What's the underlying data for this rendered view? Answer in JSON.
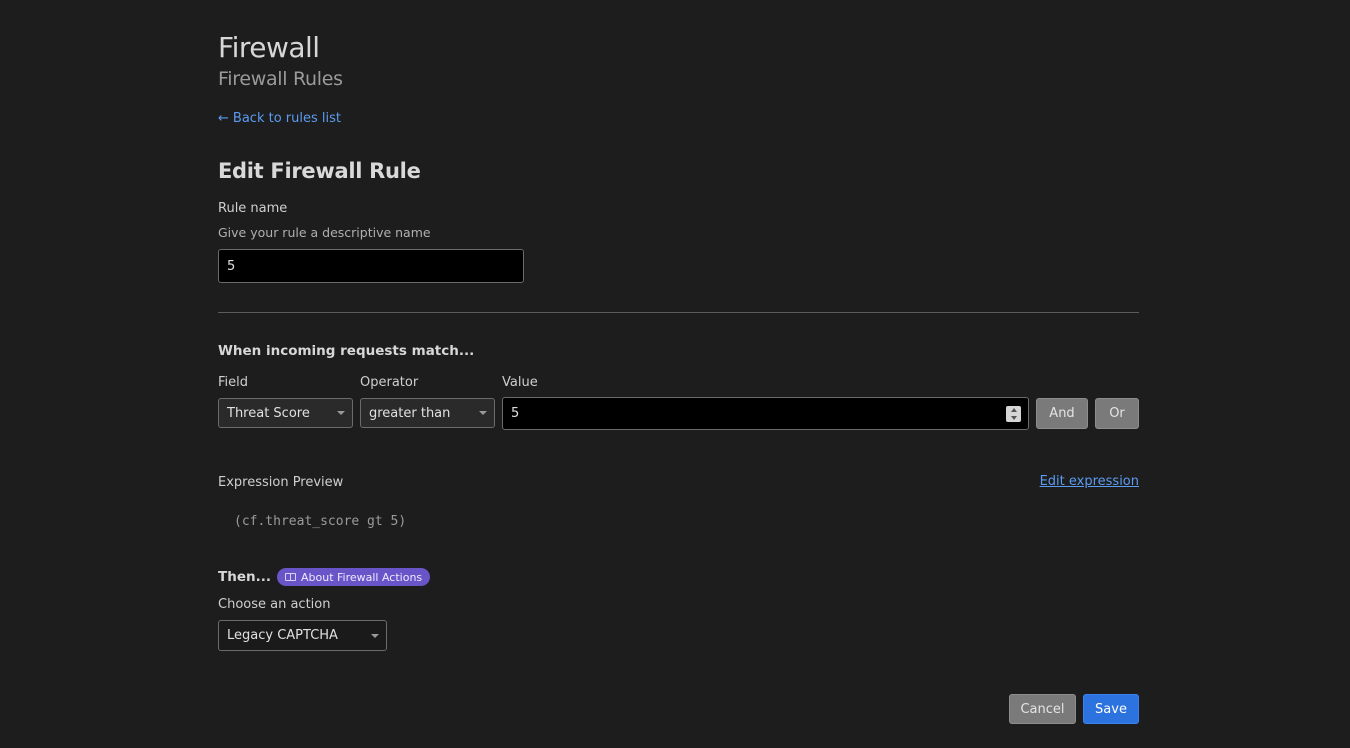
{
  "header": {
    "title": "Firewall",
    "subtitle": "Firewall Rules",
    "back_link": "Back to rules list"
  },
  "form": {
    "heading": "Edit Firewall Rule",
    "rule_name": {
      "label": "Rule name",
      "hint": "Give your rule a descriptive name",
      "value": "5"
    },
    "match": {
      "title": "When incoming requests match...",
      "field_label": "Field",
      "field_value": "Threat Score",
      "operator_label": "Operator",
      "operator_value": "greater than",
      "value_label": "Value",
      "value": "5",
      "and_label": "And",
      "or_label": "Or"
    },
    "preview": {
      "label": "Expression Preview",
      "edit_link": "Edit expression",
      "expression": "(cf.threat_score gt 5)"
    },
    "then": {
      "title": "Then...",
      "badge_label": "About Firewall Actions",
      "action_label": "Choose an action",
      "action_value": "Legacy CAPTCHA"
    },
    "buttons": {
      "cancel": "Cancel",
      "save": "Save"
    }
  },
  "colors": {
    "background": "#1d1d1d",
    "link": "#5b9bf0",
    "primary": "#2d73e0",
    "badge": "#6a55c8"
  },
  "icons": {
    "back": "arrow-left-icon",
    "badge": "book-icon",
    "select": "chevron-down-icon",
    "spinner": "spinner-icon"
  }
}
